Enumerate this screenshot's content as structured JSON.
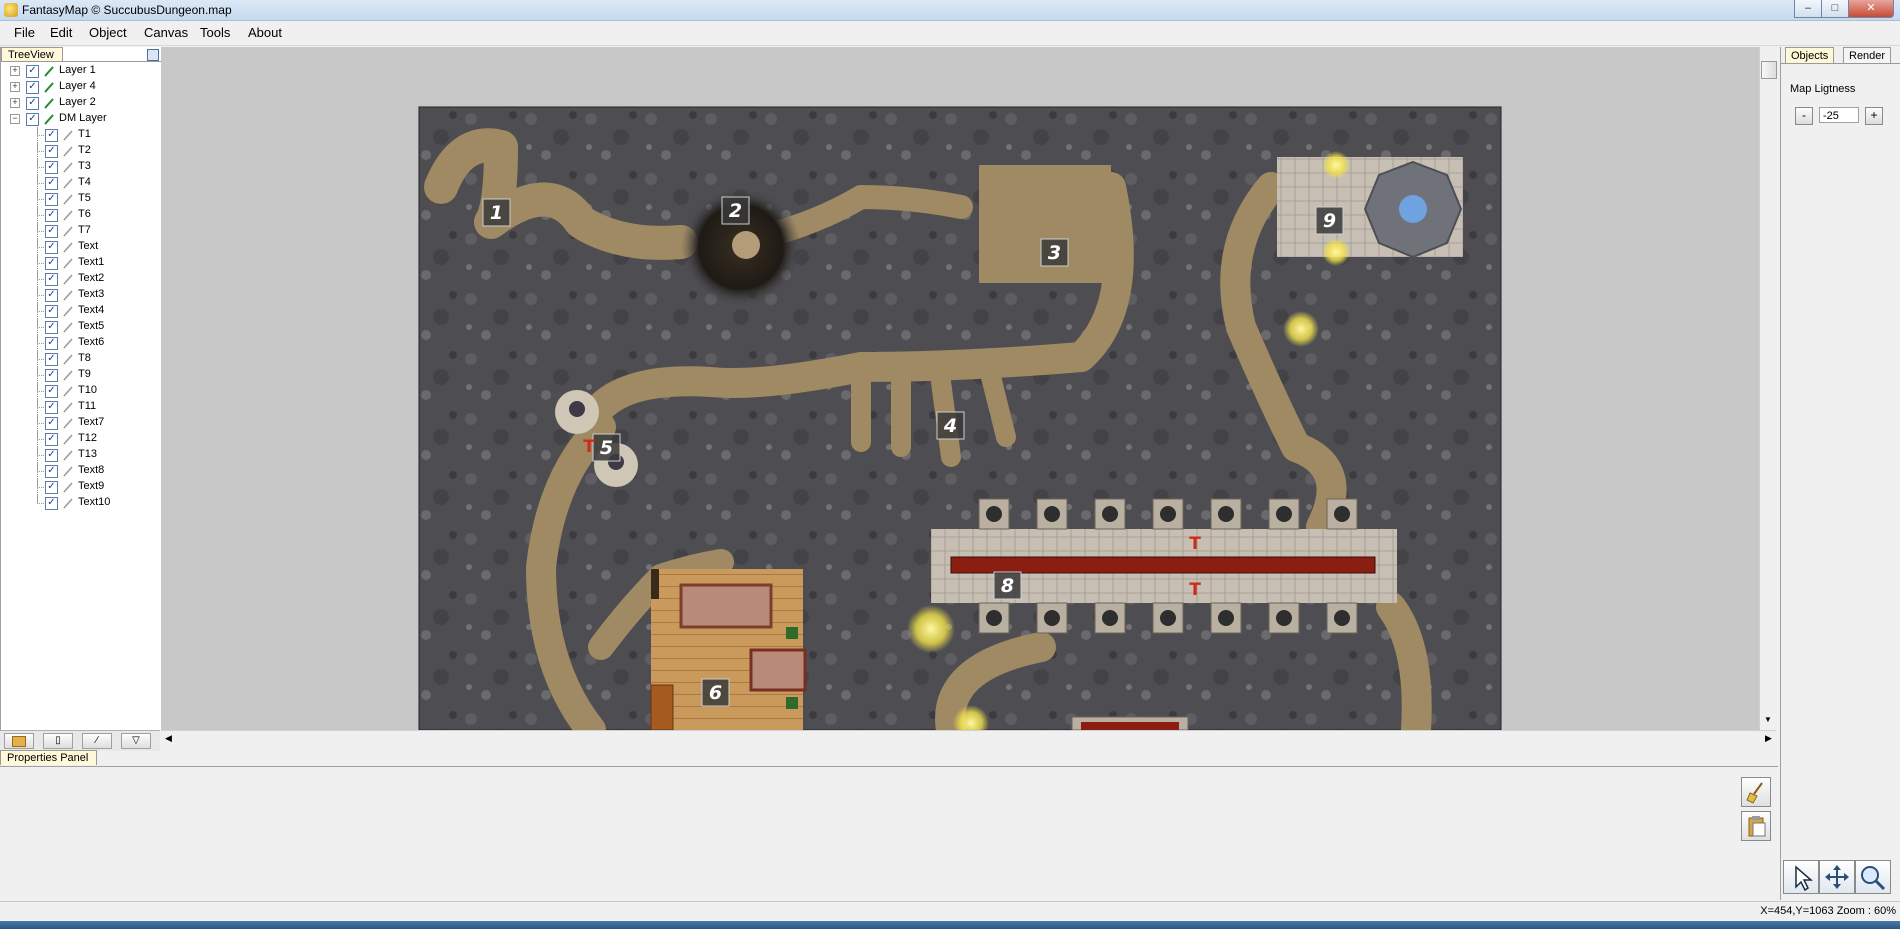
{
  "window": {
    "title": "FantasyMap © SuccubusDungeon.map"
  },
  "menu": [
    "File",
    "Edit",
    "Object",
    "Canvas",
    "Tools",
    "About"
  ],
  "treeview": {
    "tab_label": "TreeView",
    "layers": [
      {
        "label": "Layer 1",
        "expanded": false,
        "checked": true
      },
      {
        "label": "Layer 4",
        "expanded": false,
        "checked": true
      },
      {
        "label": "Layer 2",
        "expanded": false,
        "checked": true
      },
      {
        "label": "DM Layer",
        "expanded": true,
        "checked": true
      }
    ],
    "dm_children": [
      "T1",
      "T2",
      "T3",
      "T4",
      "T5",
      "T6",
      "T7",
      "Text",
      "Text1",
      "Text2",
      "Text3",
      "Text4",
      "Text5",
      "Text6",
      "T8",
      "T9",
      "T10",
      "T11",
      "Text7",
      "T12",
      "T13",
      "Text8",
      "Text9",
      "Text10"
    ]
  },
  "map": {
    "room_labels": [
      "1",
      "2",
      "3",
      "4",
      "5",
      "6",
      "8",
      "9"
    ],
    "trap_labels": [
      "T",
      "T",
      "T"
    ]
  },
  "right_panel": {
    "tabs": [
      "Objects",
      "Render"
    ],
    "map_lightness_label": "Map Ligtness",
    "map_lightness_value": "-25",
    "minus_label": "-",
    "plus_label": "+"
  },
  "properties_panel": {
    "title": "Properties Panel"
  },
  "status": {
    "text": "X=454,Y=1063  Zoom : 60%"
  },
  "colors": {
    "rock": "#4e4e52",
    "path": "#a08a63",
    "wood": "#c99a5c",
    "stone_tile": "#c7bfb3",
    "lava": "#8a1e12",
    "glow": "#f2e24a",
    "label_box": "#3a3a3a"
  }
}
